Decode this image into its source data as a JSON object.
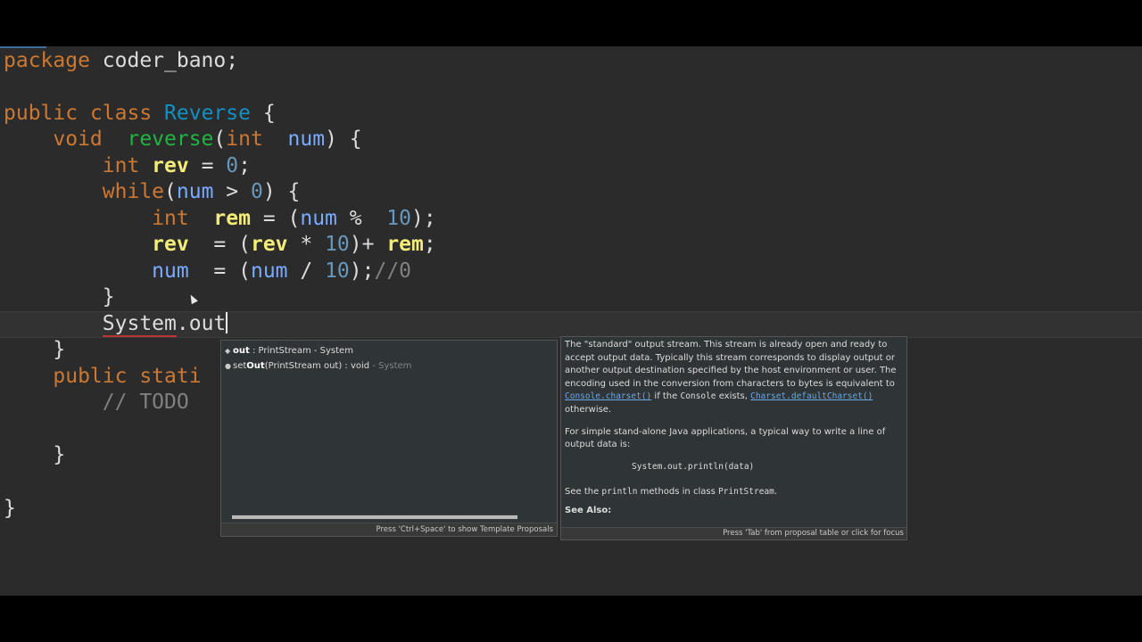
{
  "code": {
    "line1": {
      "kw": "package",
      "name": " coder_bano;"
    },
    "line2": {
      "kw1": "public",
      "kw2": " class ",
      "cls": "Reverse",
      "rest": " {"
    },
    "line3": {
      "indent": "    ",
      "kw": "void",
      "mth": "  reverse",
      "p1": "(",
      "kw2": "int",
      "sp": "  ",
      "pv": "num",
      "rest": ") {"
    },
    "line4": {
      "indent": "        ",
      "kw": "int",
      "lv": " rev",
      "eq": " = ",
      "num": "0",
      "rest": ";"
    },
    "line5": {
      "indent": "        ",
      "kw": "while",
      "p1": "(",
      "pv": "num",
      "op": " > ",
      "num": "0",
      "rest": ") {"
    },
    "line6": {
      "indent": "            ",
      "kw": "int",
      "lv": "  rem",
      "eq": " = (",
      "pv": "num",
      "op": " %  ",
      "num": "10",
      "rest": ");"
    },
    "line7": {
      "indent": "            ",
      "lv1": "rev",
      "eq": "  = (",
      "lv2": "rev",
      "op": " * ",
      "num": "10",
      "mid": ")+ ",
      "lv3": "rem",
      "rest": ";"
    },
    "line8": {
      "indent": "            ",
      "pv1": "num",
      "eq": "  = (",
      "pv2": "num",
      "op": " / ",
      "num": "10",
      "rest": ");",
      "cmt": "//0"
    },
    "line9": {
      "text": "        }"
    },
    "line10": {
      "indent": "        ",
      "squig": "System",
      "rest": ".out"
    },
    "line11": {
      "text": "    }"
    },
    "line12": {
      "indent": "    ",
      "kw1": "public",
      "kw2": " stati"
    },
    "line13": {
      "indent": "        ",
      "cmt": "// TODO"
    },
    "line14": {
      "text": "    }"
    },
    "line15": {
      "text": "}"
    }
  },
  "autocomplete": {
    "items": [
      {
        "name": "out",
        "detail": " : PrintStream - System",
        "extra": ""
      },
      {
        "name_pre": "set",
        "name": "Out",
        "detail": "(PrintStream out) : void",
        "extra": " - System"
      }
    ],
    "status": "Press 'Ctrl+Space' to show Template Proposals"
  },
  "javadoc": {
    "p1_a": "The \"standard\" output stream. This stream is already open and ready to accept output data. Typically this stream corresponds to display output or another output destination specified by the host environment or user. The encoding used in the conversion from characters to bytes is equivalent to ",
    "p1_link1": "Console.charset()",
    "p1_b": " if the ",
    "p1_code": "Console",
    "p1_c": " exists, ",
    "p1_link2": "Charset.defaultCharset()",
    "p1_d": " otherwise.",
    "p2": "For simple stand-alone Java applications, a typical way to write a line of output data is:",
    "pre": "System.out.println(data)",
    "p3_a": "See the ",
    "p3_code1": "println",
    "p3_b": " methods in class ",
    "p3_code2": "PrintStream",
    "p3_c": ".",
    "see_also": "See Also:",
    "status": "Press 'Tab' from proposal table or click for focus"
  }
}
